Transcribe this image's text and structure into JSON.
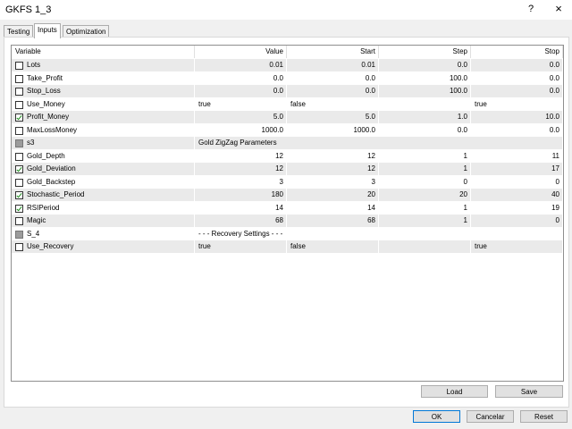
{
  "window": {
    "title": "GKFS 1_3",
    "help_label": "?",
    "close_label": "×"
  },
  "tabs": [
    {
      "label": "Testing"
    },
    {
      "label": "Inputs"
    },
    {
      "label": "Optimization"
    }
  ],
  "active_tab": "Inputs",
  "table": {
    "columns": [
      "Variable",
      "Value",
      "Start",
      "Step",
      "Stop"
    ],
    "rows": [
      {
        "name": "Lots",
        "checked": false,
        "value": "0.01",
        "start": "0.01",
        "step": "0.0",
        "stop": "0.0"
      },
      {
        "name": "Take_Profit",
        "checked": false,
        "value": "0.0",
        "start": "0.0",
        "step": "100.0",
        "stop": "0.0"
      },
      {
        "name": "Stop_Loss",
        "checked": false,
        "value": "0.0",
        "start": "0.0",
        "step": "100.0",
        "stop": "0.0"
      },
      {
        "name": "Use_Money",
        "checked": false,
        "value": "true",
        "start": "false",
        "step": "",
        "stop": "true"
      },
      {
        "name": "Profit_Money",
        "checked": true,
        "value": "5.0",
        "start": "5.0",
        "step": "1.0",
        "stop": "10.0"
      },
      {
        "name": "MaxLossMoney",
        "checked": false,
        "value": "1000.0",
        "start": "1000.0",
        "step": "0.0",
        "stop": "0.0"
      },
      {
        "name": "s3",
        "group": true,
        "label": "Gold ZigZag Parameters"
      },
      {
        "name": "Gold_Depth",
        "checked": false,
        "value": "12",
        "start": "12",
        "step": "1",
        "stop": "11"
      },
      {
        "name": "Gold_Deviation",
        "checked": true,
        "value": "12",
        "start": "12",
        "step": "1",
        "stop": "17"
      },
      {
        "name": "Gold_Backstep",
        "checked": false,
        "value": "3",
        "start": "3",
        "step": "0",
        "stop": "0"
      },
      {
        "name": "Stochastic_Period",
        "checked": true,
        "value": "180",
        "start": "20",
        "step": "20",
        "stop": "40"
      },
      {
        "name": "RSIPeriod",
        "checked": true,
        "value": "14",
        "start": "14",
        "step": "1",
        "stop": "19"
      },
      {
        "name": "Magic",
        "checked": false,
        "value": "68",
        "start": "68",
        "step": "1",
        "stop": "0"
      },
      {
        "name": "S_4",
        "group": true,
        "label": "- - - Recovery Settings - - -"
      },
      {
        "name": "Use_Recovery",
        "checked": false,
        "value": "true",
        "start": "false",
        "step": "",
        "stop": "true"
      }
    ]
  },
  "buttons": {
    "load": "Load",
    "save": "Save",
    "ok": "OK",
    "cancel": "Cancelar",
    "reset": "Reset"
  }
}
